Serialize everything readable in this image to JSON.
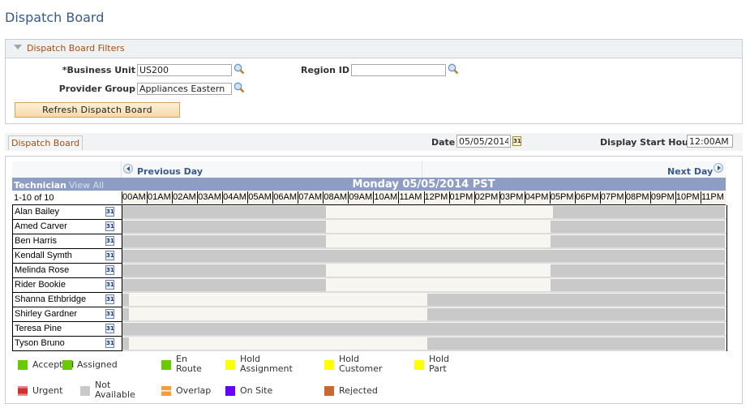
{
  "page": {
    "title": "Dispatch Board"
  },
  "filters": {
    "section_title": "Dispatch Board Filters",
    "business_unit": {
      "label": "*Business Unit",
      "value": "US200"
    },
    "region_id": {
      "label": "Region ID",
      "value": ""
    },
    "provider_group": {
      "label": "Provider Group",
      "value": "Appliances Eastern"
    },
    "refresh_label": "Refresh Dispatch Board"
  },
  "board_bar": {
    "tab_label": "Dispatch Board",
    "date_label": "Date",
    "date_value": "05/05/2014",
    "start_hour_label": "Display Start Hour",
    "start_hour_value": "12:00AM",
    "calendar_icon_text": "31"
  },
  "grid": {
    "previous_day": "Previous Day",
    "next_day": "Next Day",
    "technician_header": "Technician",
    "view_all": "View All",
    "day_title": "Monday 05/05/2014 PST",
    "count": "1-10 of 10",
    "hours": [
      "00AM",
      "01AM",
      "02AM",
      "03AM",
      "04AM",
      "05AM",
      "06AM",
      "07AM",
      "08AM",
      "09AM",
      "10AM",
      "11AM",
      "12PM",
      "01PM",
      "02PM",
      "03PM",
      "04PM",
      "05PM",
      "06PM",
      "07PM",
      "08PM",
      "09PM",
      "10PM",
      "11PM"
    ],
    "technicians": [
      {
        "name": "Alan Bailey",
        "not_available": [
          [
            0,
            8.1
          ],
          [
            17.1,
            24
          ]
        ]
      },
      {
        "name": "Amed Carver",
        "not_available": [
          [
            0,
            8.1
          ],
          [
            17.0,
            24
          ]
        ]
      },
      {
        "name": "Ben Harris",
        "not_available": [
          [
            0,
            8.1
          ],
          [
            17.0,
            24
          ]
        ]
      },
      {
        "name": "Kendall Symth",
        "not_available": [
          [
            0,
            24
          ]
        ]
      },
      {
        "name": "Melinda Rose",
        "not_available": [
          [
            0,
            8.1
          ],
          [
            17.0,
            24
          ]
        ]
      },
      {
        "name": "Rider Bookie",
        "not_available": [
          [
            0,
            8.1
          ],
          [
            17.0,
            24
          ]
        ]
      },
      {
        "name": "Shanna Ethbridge",
        "not_available": [
          [
            0,
            0.25
          ],
          [
            12.1,
            24
          ]
        ]
      },
      {
        "name": "Shirley Gardner",
        "not_available": [
          [
            0,
            0.25
          ],
          [
            12.1,
            24
          ]
        ]
      },
      {
        "name": "Teresa Pine",
        "not_available": [
          [
            0,
            24
          ]
        ]
      },
      {
        "name": "Tyson Bruno",
        "not_available": [
          [
            0,
            0.25
          ],
          [
            12.1,
            24
          ]
        ]
      }
    ]
  },
  "legend": [
    {
      "label": "Accepted",
      "color": "#66cc00"
    },
    {
      "label": "Assigned",
      "color": "#66cc00"
    },
    {
      "label": "En\nRoute",
      "color": "#66cc00"
    },
    {
      "label": "Hold\nAssignment",
      "color": "#ffff00"
    },
    {
      "label": "Hold\nCustomer",
      "color": "#ffff00"
    },
    {
      "label": "Hold\nPart",
      "color": "#ffff00"
    },
    {
      "label": "Urgent",
      "color": "#cc3333"
    },
    {
      "label": "Not\nAvailable",
      "color": "#c9c9c9"
    },
    {
      "label": "Overlap",
      "color": "#ff9933"
    },
    {
      "label": "On Site",
      "color": "#6600ff"
    },
    {
      "label": "Rejected",
      "color": "#cc6633"
    }
  ]
}
